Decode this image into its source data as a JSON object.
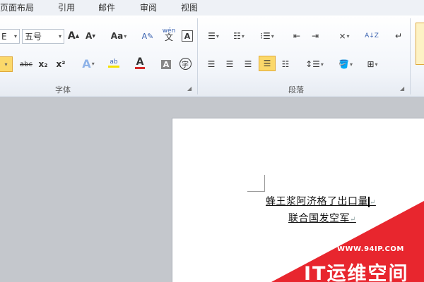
{
  "tabs": [
    "页面布局",
    "引用",
    "邮件",
    "审阅",
    "视图"
  ],
  "font_group": {
    "font_name": "E",
    "font_size": "五号",
    "grow_label": "A",
    "shrink_label": "A",
    "case_label": "Aa",
    "pinyin_label": "wén",
    "char_border_label": "A",
    "strike_label": "abc",
    "subscript_label": "x₂",
    "superscript_label": "x²",
    "effects_label": "A",
    "highlight_label": "ab",
    "font_color_label": "A",
    "shading_label": "A",
    "enclose_label": "字",
    "label": "字体"
  },
  "paragraph_group": {
    "label": "段落",
    "sort_label": "A↓Z"
  },
  "document": {
    "line1": "蜂王浆阿济格了出口量",
    "line2": "联合国发空军"
  },
  "watermark": {
    "url": "WWW.94IP.COM",
    "name": "IT运维空间"
  },
  "colors": {
    "accent_highlight": "#fbd86a",
    "font_color": "#d42a2a",
    "banner_red": "#e8262e"
  }
}
